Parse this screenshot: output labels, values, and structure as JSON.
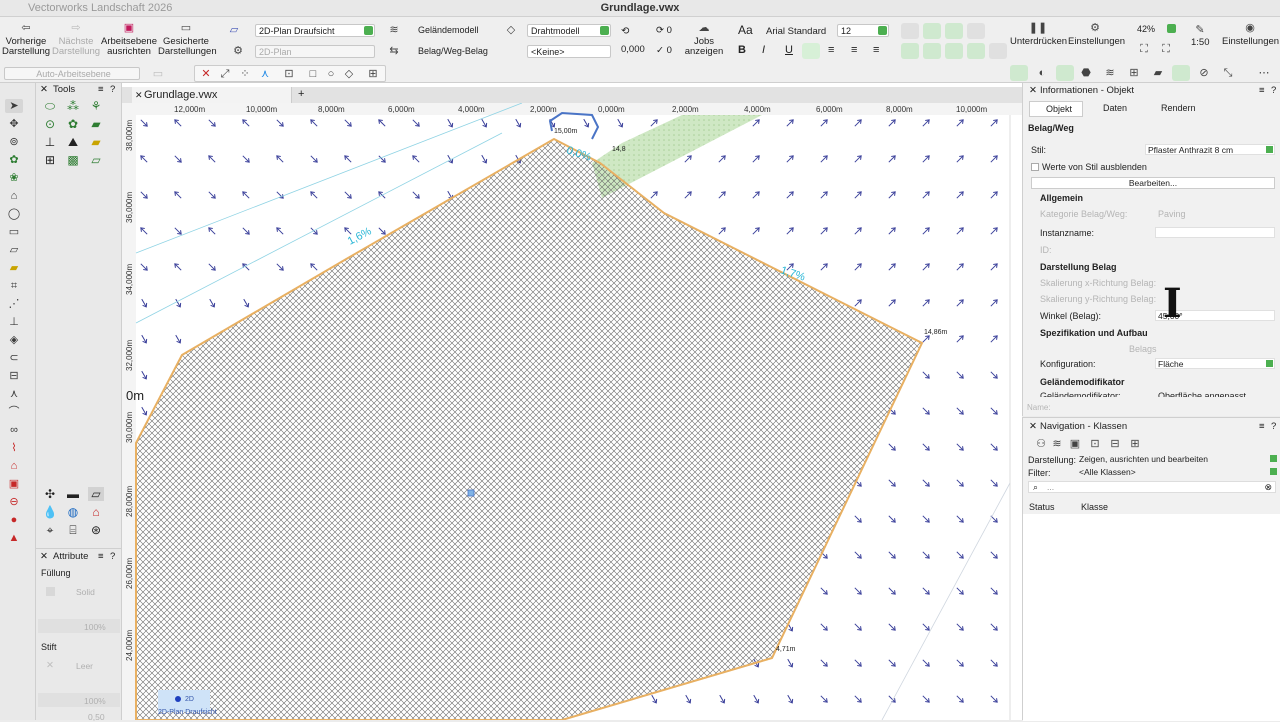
{
  "titlebar": {
    "app": "Vectorworks Landschaft 2026",
    "document": "Grundlage.vwx"
  },
  "toolbar": {
    "prev_view": [
      "Vorherige",
      "Darstellung"
    ],
    "next_view": [
      "Nächste",
      "Darstellung"
    ],
    "align_plane": [
      "Arbeitsebene",
      "ausrichten"
    ],
    "saved_views": [
      "Gesicherte",
      "Darstellungen"
    ],
    "view_dropdown": "2D-Plan Draufsicht",
    "view2_dropdown": "2D-Plan",
    "layer_dropdown": "Geländemodell",
    "class_dropdown": "Belag/Weg-Belag",
    "render_dropdown": "Drahtmodell",
    "keine_dropdown": "<Keine>",
    "num_value": "0,000",
    "counter_top": "0",
    "counter_bottom": "0",
    "jobs": [
      "Jobs",
      "anzeigen"
    ],
    "font_name": "Arial Standard",
    "font_size": "12",
    "suspend": "Unterdrücken",
    "settings": "Einstellungen",
    "zoom": "42%",
    "scale": "1:50",
    "settings2": "Einstellungen",
    "workplane": "Auto-Arbeitsebene"
  },
  "tools_palette": {
    "title": "Tools"
  },
  "attr_palette": {
    "title": "Attribute",
    "fill_label": "Füllung",
    "fill_value": "Solid",
    "fill_pct": "100%",
    "pen_label": "Stift",
    "pen_value": "Leer",
    "pen_pct": "100%",
    "pen_num": "0,50"
  },
  "document": {
    "tab": "Grundlage.vwx",
    "ruler_labels": [
      "12,000m",
      "10,000m",
      "8,000m",
      "6,000m",
      "4,000m",
      "2,000m",
      "0,000m",
      "2,000m",
      "4,000m",
      "6,000m",
      "8,000m",
      "10,000m"
    ],
    "vruler_labels": [
      "38,000m",
      "36,000m",
      "34,000m",
      "32,000m",
      "30,000m",
      "28,000m",
      "26,000m",
      "24,000m"
    ],
    "slope_labels": [
      "1,6%",
      "1,7%",
      "0,0%"
    ],
    "elevations": [
      "15,00m",
      "14,86m",
      "14,8",
      "4,71m"
    ],
    "big_label": "0m",
    "view_badge_top": "2D",
    "view_badge": "2D-Plan Draufsicht"
  },
  "info_palette": {
    "title": "Informationen - Objekt",
    "tabs": [
      "Objekt",
      "Daten",
      "Rendern"
    ],
    "object_type": "Belag/Weg",
    "style_label": "Stil:",
    "style_value": "Pflaster Anthrazit 8 cm",
    "hide_style": "Werte von Stil ausblenden",
    "edit_btn": "Bearbeiten...",
    "sec_general": "Allgemein",
    "cat_label": "Kategorie Belag/Weg:",
    "cat_value": "Paving",
    "instance_label": "Instanzname:",
    "id_label": "ID:",
    "sec_display": "Darstellung Belag",
    "scale_x": "Skalierung x-Richtung Belag:",
    "scale_y": "Skalierung y-Richtung Belag:",
    "angle_label": "Winkel (Belag):",
    "angle_value": "45,00°",
    "sec_spec": "Spezifikation und Aufbau",
    "belag_label": "Belags",
    "config_label": "Konfiguration:",
    "config_value": "Fläche",
    "sec_terrain": "Geländemodifikator",
    "terrain_label": "Geländemodifikator:",
    "terrain_value": "Oberfläche angepasst",
    "name_label": "Name:"
  },
  "nav_palette": {
    "title": "Navigation - Klassen",
    "display_label": "Darstellung:",
    "display_value": "Zeigen, ausrichten und bearbeiten",
    "filter_label": "Filter:",
    "filter_value": "<Alle Klassen>",
    "search_placeholder": "...",
    "col_status": "Status",
    "col_class": "Klasse"
  },
  "colors": {
    "accent_green": "#4caf50",
    "polygon_outline": "#e8b062",
    "arrow_blue": "#3a3f9a",
    "slope_cyan": "#29b6d6"
  }
}
